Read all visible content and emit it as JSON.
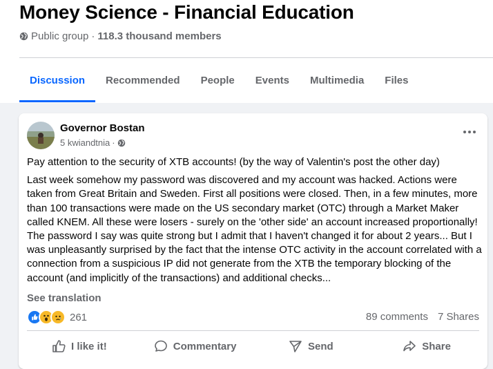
{
  "group": {
    "title": "Money Science - Financial Education",
    "privacy": "Public group",
    "separator": "·",
    "members": "118.3 thousand members"
  },
  "tabs": [
    {
      "label": "Discussion",
      "active": true
    },
    {
      "label": "Recommended"
    },
    {
      "label": "People"
    },
    {
      "label": "Events"
    },
    {
      "label": "Multimedia"
    },
    {
      "label": "Files"
    }
  ],
  "post": {
    "author": "Governor Bostan",
    "time": "5 kwiandtnia",
    "separator": "·",
    "text_intro": "Pay attention to the security of XTB accounts! (by the way of Valentin's post the other day)",
    "text_body": "Last week somehow my password was discovered and my account was hacked. Actions were taken from Great Britain and Sweden. First all positions were closed. Then, in a few minutes, more than 100 transactions were made on the US secondary market (OTC) through a Market Maker called KNEM. All these were losers - surely on the 'other side' an account increased proportionally! The password I say was quite strong but I admit that I haven't changed it for about 2 years... But I was unpleasantly surprised by the fact that the intense OTC activity in the account correlated with a connection from a suspicious IP did not generate from the XTB the temporary blocking of the account (and implicitly of the transactions) and additional checks...",
    "see_translation": "See translation",
    "reactions_count": "261",
    "comments": "89 comments",
    "shares": "7 Shares"
  },
  "actions": {
    "like": "I like it!",
    "comment": "Commentary",
    "send": "Send",
    "share": "Share"
  },
  "colors": {
    "accent": "#0866ff",
    "muted_text": "#65676b",
    "background": "#f0f2f5"
  }
}
